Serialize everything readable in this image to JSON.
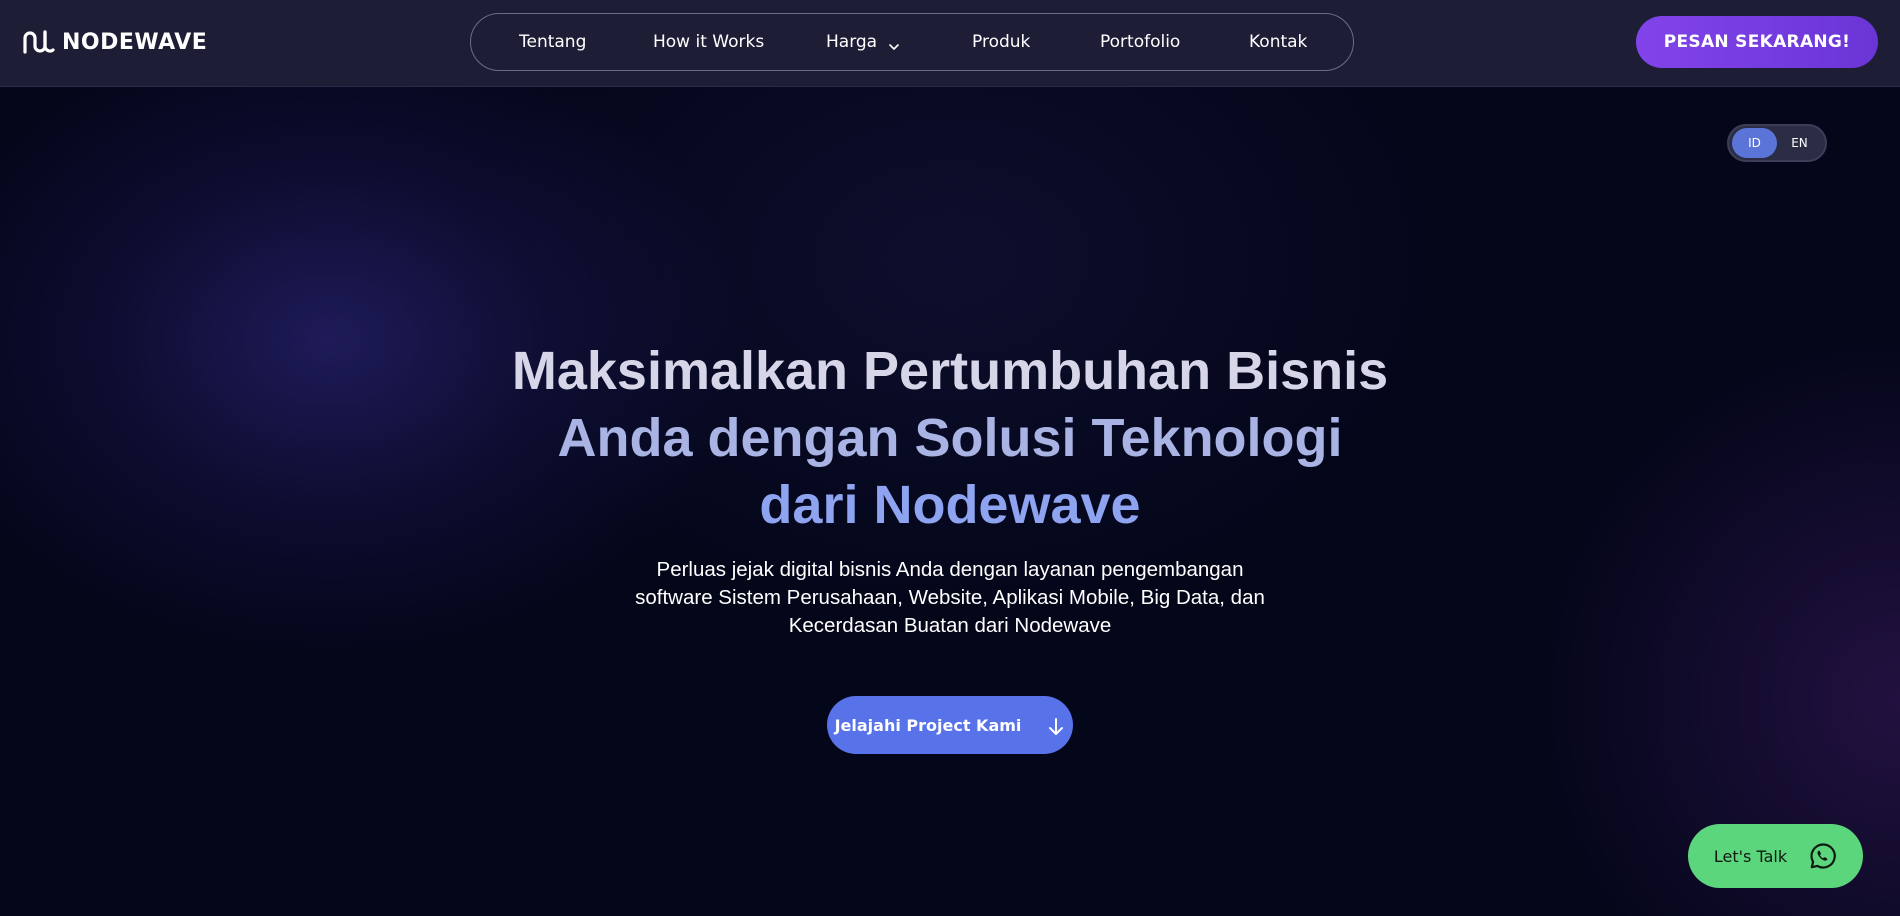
{
  "header": {
    "logo_text": "NODEWAVE",
    "nav": [
      {
        "label": "Tentang"
      },
      {
        "label": "How it Works"
      },
      {
        "label": "Harga"
      },
      {
        "label": "Produk"
      },
      {
        "label": "Portofolio"
      },
      {
        "label": "Kontak"
      }
    ],
    "cta_label": "PESAN SEKARANG!"
  },
  "language": {
    "options": [
      "ID",
      "EN"
    ],
    "selected": "ID"
  },
  "hero": {
    "title_line1": "Maksimalkan Pertumbuhan Bisnis",
    "title_line2": "Anda dengan Solusi Teknologi",
    "title_line3": "dari Nodewave",
    "subtitle_line1": "Perluas jejak digital bisnis Anda dengan layanan pengembangan",
    "subtitle_line2": "software Sistem Perusahaan, Website, Aplikasi Mobile, Big Data, dan",
    "subtitle_line3": "Kecerdasan Buatan dari Nodewave",
    "button_label": "Jelajahi Project Kami"
  },
  "chat": {
    "label": "Let's Talk"
  },
  "icons": {
    "logo": "nodewave-wave-icon",
    "dropdown": "chevron-down-icon",
    "explore": "arrow-down-icon",
    "chat": "whatsapp-icon"
  },
  "colors": {
    "header_bg": "#1d1e36",
    "page_bg": "#04061a",
    "cta": "#7a3fe0",
    "explore_button": "#5872ea",
    "lang_active": "#5b74d8",
    "chat_button": "#5cd67c"
  }
}
